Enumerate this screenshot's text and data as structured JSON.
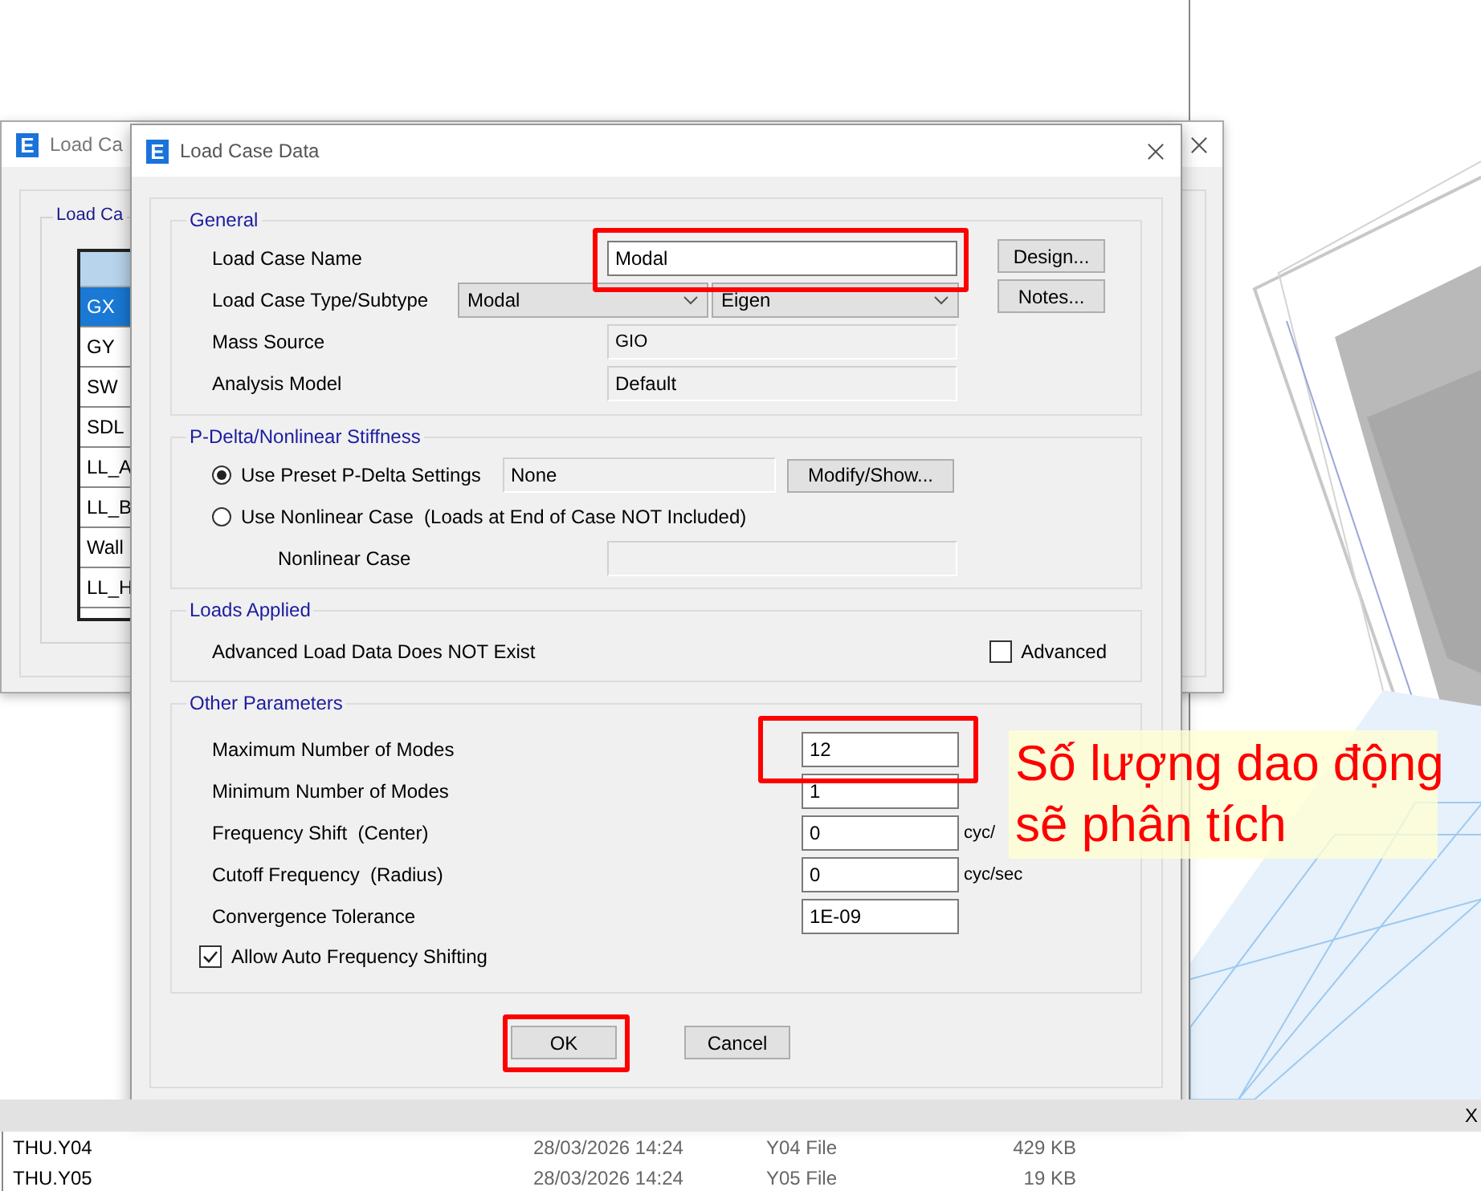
{
  "back_window": {
    "app_icon": "E",
    "title": "Load Ca",
    "group_label": "Load Ca",
    "list": [
      {
        "label": "GX",
        "selected": true
      },
      {
        "label": "GY",
        "selected": false
      },
      {
        "label": "SW",
        "selected": false
      },
      {
        "label": "SDL",
        "selected": false
      },
      {
        "label": "LL_A",
        "selected": false
      },
      {
        "label": "LL_B",
        "selected": false
      },
      {
        "label": "Wall",
        "selected": false
      },
      {
        "label": "LL_H",
        "selected": false
      }
    ]
  },
  "dialog": {
    "app_icon": "E",
    "title": "Load Case Data",
    "general": {
      "title": "General",
      "name_label": "Load Case Name",
      "name_value": "Modal",
      "type_label": "Load Case Type/Subtype",
      "type": "Modal",
      "subtype": "Eigen",
      "mass_source_label": "Mass Source",
      "mass_source": "GIO",
      "analysis_model_label": "Analysis Model",
      "analysis_model": "Default",
      "buttons": [
        "Design...",
        "Notes..."
      ]
    },
    "pdelta": {
      "title": "P-Delta/Nonlinear Stiffness",
      "options": [
        {
          "label": "Use Preset P-Delta Settings",
          "selected": true,
          "value": "None",
          "button": "Modify/Show..."
        },
        {
          "label": "Use Nonlinear Case  (Loads at End of Case NOT Included)",
          "selected": false
        }
      ],
      "nonlinear_case_label": "Nonlinear Case"
    },
    "loads_applied": {
      "title": "Loads Applied",
      "text": "Advanced Load Data Does NOT Exist",
      "advanced": {
        "label": "Advanced",
        "checked": false
      }
    },
    "other_parameters": {
      "title": "Other Parameters",
      "fields": [
        {
          "label": "Maximum Number of Modes",
          "value": "12"
        },
        {
          "label": "Minimum Number of Modes",
          "value": "1"
        },
        {
          "label": "Frequency Shift  (Center)",
          "value": "0",
          "unit": "cyc/"
        },
        {
          "label": "Cutoff Frequency  (Radius)",
          "value": "0",
          "unit": "cyc/sec"
        },
        {
          "label": "Convergence Tolerance",
          "value": "1E-09"
        }
      ],
      "auto_shift": {
        "label": "Allow Auto Frequency Shifting",
        "checked": true
      }
    },
    "buttons": [
      "OK",
      "Cancel"
    ]
  },
  "annotation": {
    "lines": [
      "Số lượng dao động",
      "sẽ phân tích"
    ]
  },
  "bottom_bar": {
    "close": "X"
  },
  "file_list": {
    "rows": [
      {
        "name": "THU.Y04",
        "date": "28/03/2026 14:24",
        "type": "Y04 File",
        "size": "429 KB"
      },
      {
        "name": "THU.Y05",
        "date": "28/03/2026 14:24",
        "type": "Y05 File",
        "size": "19 KB"
      }
    ]
  }
}
